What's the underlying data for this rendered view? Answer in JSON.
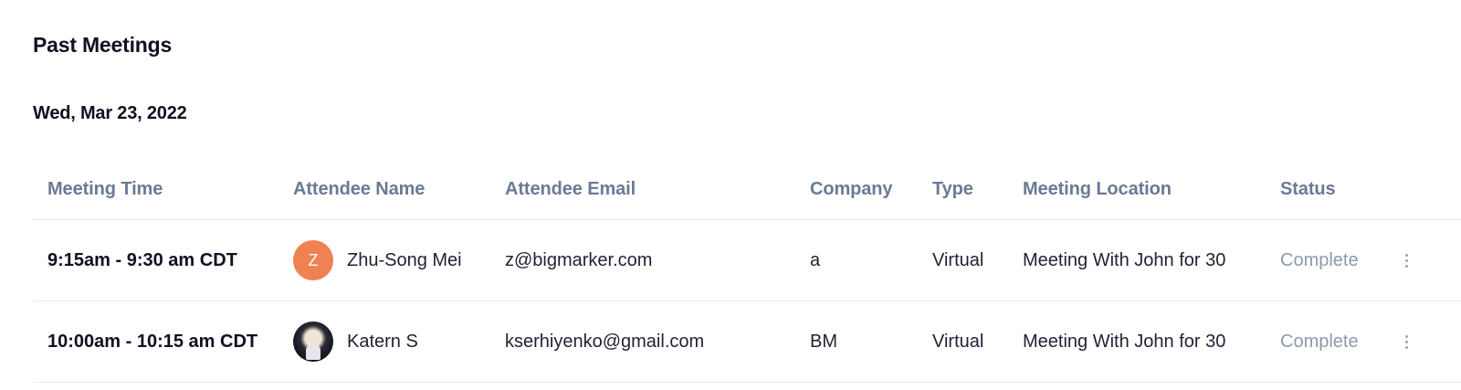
{
  "page": {
    "title": "Past Meetings",
    "date_heading": "Wed, Mar 23, 2022"
  },
  "table": {
    "columns": {
      "meeting_time": "Meeting Time",
      "attendee_name": "Attendee Name",
      "attendee_email": "Attendee Email",
      "company": "Company",
      "type": "Type",
      "meeting_location": "Meeting Location",
      "status": "Status"
    },
    "rows": [
      {
        "meeting_time": "9:15am - 9:30 am CDT",
        "avatar_initial": "Z",
        "avatar_color": "#ef8153",
        "attendee_name": "Zhu-Song Mei",
        "attendee_email": "z@bigmarker.com",
        "company": "a",
        "type": "Virtual",
        "meeting_location": "Meeting With John for 30",
        "status": "Complete",
        "menu_icon": "kebab-menu-icon"
      },
      {
        "meeting_time": "10:00am - 10:15 am CDT",
        "avatar_initial": "",
        "avatar_color": "#12131c",
        "attendee_name": "Katern S",
        "attendee_email": "kserhiyenko@gmail.com",
        "company": "BM",
        "type": "Virtual",
        "meeting_location": "Meeting With John for 30",
        "status": "Complete",
        "menu_icon": "kebab-menu-icon"
      }
    ]
  },
  "colors": {
    "header_text": "#6b7a94",
    "status_text": "#8d99b0",
    "divider": "#e8ebef"
  }
}
